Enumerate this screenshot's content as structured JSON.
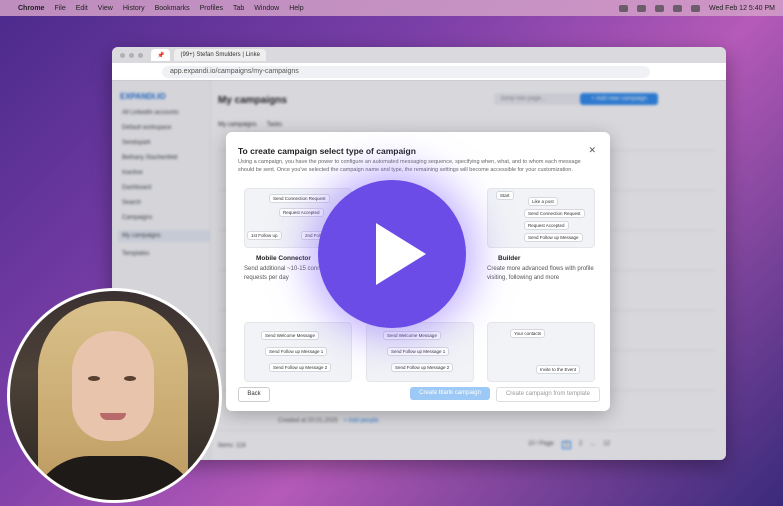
{
  "menubar": {
    "apple": "",
    "app": "Chrome",
    "items": [
      "File",
      "Edit",
      "View",
      "History",
      "Bookmarks",
      "Profiles",
      "Tab",
      "Window",
      "Help"
    ],
    "clock": "Wed Feb 12  5:40 PM"
  },
  "browser": {
    "tab1": "",
    "tab2": "(99+) Stefan Smulders | Linke",
    "url": "app.expandi.io/campaigns/my-campaigns"
  },
  "sidebar": {
    "logo": "EXPANDI.IO",
    "accounts": "All LinkedIn accounts",
    "workspace": "Default workspace",
    "section": "Sendspark",
    "user_name": "Bethany Stachenfeld",
    "user_status": "Inactive",
    "nav": [
      "Dashboard",
      "Search",
      "Campaigns",
      "My campaigns",
      "Templates"
    ]
  },
  "main": {
    "title": "My campaigns",
    "jump_placeholder": "Jump into page...",
    "add_button": "+ Add new campaign",
    "tabs": [
      "My campaigns",
      "Tasks"
    ],
    "items_count": "Items: 118",
    "per_page": "10 / Page",
    "pages": [
      "1",
      "2",
      "...",
      "12"
    ],
    "created": "Created at 20.01.2025",
    "add_people": "+ Add people"
  },
  "modal": {
    "title": "To create campaign select type of campaign",
    "description": "Using a campaign, you have the power to configure an automated messaging sequence, specifying when, what, and to whom each message should be sent. Once you've selected the campaign name and type, the remaining settings will become accessible for your customization.",
    "card1": {
      "nodes": [
        "Send Connection Request",
        "Request Accepted",
        "1st Follow up",
        "2nd Follow up"
      ],
      "title": "Mobile Connector",
      "desc": "Send additional ~10-15 conn requests per day"
    },
    "card3": {
      "nodes": [
        "Start",
        "Like a post",
        "Send Connection Request",
        "Request Accepted",
        "Send Follow up Message"
      ],
      "title": "Builder",
      "desc": "Create more advanced flows with profile visiting, following and more"
    },
    "card4": {
      "nodes": [
        "Send Welcome Message",
        "Send Follow up Message 1",
        "Send Follow up Message 2"
      ]
    },
    "card5": {
      "nodes": [
        "Send Welcome Message",
        "Send Follow up Message 1",
        "Send Follow up Message 2"
      ]
    },
    "card6": {
      "nodes": [
        "Your contacts",
        "Invite to the Event"
      ]
    },
    "back": "Back",
    "create_blank": "Create blank campaign",
    "create_template": "Create campaign from template"
  }
}
